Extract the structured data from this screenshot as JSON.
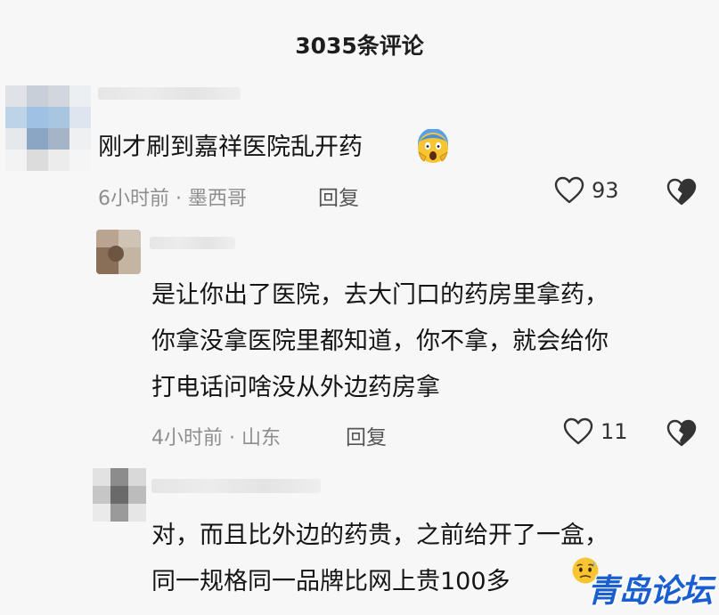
{
  "header": {
    "title": "3035条评论"
  },
  "comments": [
    {
      "text_lines": [
        "刚才刷到嘉祥医院乱开药"
      ],
      "emoji": "scream-emoji",
      "time": "6小时前",
      "location": "墨西哥",
      "reply_label": "回复",
      "likes": "93"
    }
  ],
  "replies": [
    {
      "text_lines": [
        "是让你出了医院，去大门口的药房里拿药，",
        "你拿没拿医院里都知道，你不拿，就会给你",
        "打电话问啥没从外边药房拿"
      ],
      "time": "4小时前",
      "location": "山东",
      "reply_label": "回复",
      "likes": "11"
    },
    {
      "text_lines": [
        "对，而且比外边的药贵，之前给开了一盒，",
        "同一规格同一品牌比网上贵100多"
      ]
    }
  ],
  "meta_separator": " · ",
  "icons": {
    "like": "heart-outline-icon",
    "dislike": "broken-heart-icon"
  },
  "watermark": {
    "text": "青岛论坛"
  },
  "colors": {
    "background": "#f7f7f7",
    "text": "#141414",
    "meta": "#8e8e8e",
    "watermark": "#1a5fd0"
  }
}
